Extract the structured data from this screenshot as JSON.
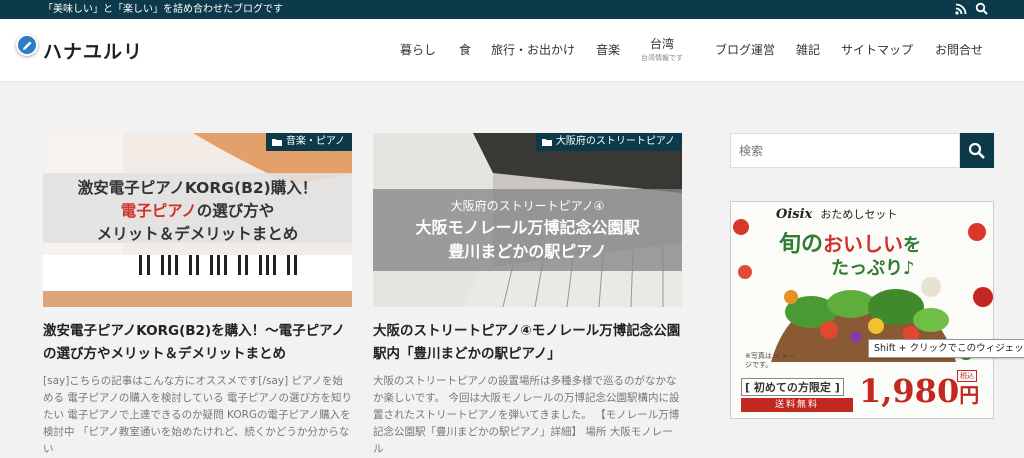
{
  "topbar": {
    "tagline": "「美味しい」と「楽しい」を詰め合わせたブログです",
    "icons": [
      "rss-icon",
      "search-icon"
    ]
  },
  "site": {
    "title": "ハナユルリ"
  },
  "nav": [
    {
      "label": "暮らし"
    },
    {
      "label": "食"
    },
    {
      "label": "旅行・お出かけ"
    },
    {
      "label": "音楽"
    },
    {
      "label": "台湾",
      "sub": "台湾情報です"
    },
    {
      "label": "ブログ運営"
    },
    {
      "label": "雑記"
    },
    {
      "label": "サイトマップ"
    },
    {
      "label": "お問合せ"
    }
  ],
  "posts": [
    {
      "category": "音楽・ピアノ",
      "thumb_line1": "激安電子ピアノKORG(B2)購入！",
      "thumb_line2": "電子ピアノ",
      "thumb_line2b": "の選び方や",
      "thumb_line3": "メリット＆デメリットまとめ",
      "title": "激安電子ピアノKORG(B2)を購入！〜電子ピアノの選び方やメリット＆デメリットまとめ",
      "excerpt": "[say]こちらの記事はこんな方にオススメです[/say] ピアノを始める 電子ピアノの購入を検討している 電子ピアノの選び方を知りたい 電子ピアノで上達できるのか疑問 KORGの電子ピアノ購入を検討中 「ピアノ教室通いを始めたけれど、続くかどうか分からない"
    },
    {
      "category": "大阪府のストリートピアノ",
      "thumb_line1": "大阪府のストリートピアノ④",
      "thumb_line2": "大阪モノレール万博記念公園駅",
      "thumb_line3": "豊川まどかの駅ピアノ",
      "title": "大阪のストリートピアノ④モノレール万博記念公園駅内「豊川まどかの駅ピアノ」",
      "excerpt": "大阪のストリートピアノの設置場所は多種多様で巡るのがなかなか楽しいです。 今回は大阪モノレールの万博記念公園駅構内に設置されたストリートピアノを弾いてきました。 【モノレール万博記念公園駅「豊川まどかの駅ピアノ」詳細】 場所 大阪モノレール"
    }
  ],
  "sidebar": {
    "search_placeholder": "検索",
    "ad": {
      "brand": "Oisix",
      "brand_sub": "おためしセット",
      "headline1": "旬の",
      "headline2": "おいしい",
      "headline3": "を",
      "headline4": "たっぷり♪",
      "note": "※写真は イメージです。",
      "first_time": "初めての方限定",
      "price": "1,980",
      "yen": "円",
      "tax": "税込",
      "shipping": "送料無料"
    }
  },
  "tooltip": {
    "text": "Shift + クリックでこのウィジェットを編"
  },
  "colors": {
    "topbar": "#0d3a4a",
    "accent_red": "#d0312d",
    "ad_green": "#2e7d32"
  }
}
